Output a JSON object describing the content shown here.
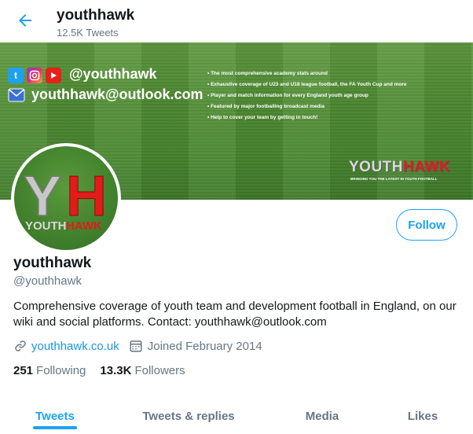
{
  "header": {
    "title": "youthhawk",
    "tweet_count": "12.5K Tweets"
  },
  "banner": {
    "handle": "@youthhawk",
    "email": "youthhawk@outlook.com",
    "bullets": [
      "• The most comprehensive academy stats around",
      "• Exhaustive coverage of U23 and U18 league football, the FA Youth Cup and more",
      "• Player and match information for every England youth age group",
      "• Featured by major footballing broadcast media",
      "• Help to cover your team by getting in touch!"
    ],
    "logo_left": "YOUTH",
    "logo_right": "HAWK",
    "tagline": "BRINGING YOU THE LATEST IN YOUTH FOOTBALL"
  },
  "avatar": {
    "letters_left": "Y",
    "letters_right": "H",
    "word_left": "YOUTH",
    "word_right": "HAWK"
  },
  "profile": {
    "name": "youthhawk",
    "handle": "@youthhawk",
    "bio": "Comprehensive coverage of youth team and development football in England, on our wiki and social platforms. Contact: youthhawk@outlook.com",
    "website": "youthhawk.co.uk",
    "joined": "Joined February 2014",
    "following_count": "251",
    "following_label": "Following",
    "followers_count": "13.3K",
    "followers_label": "Followers",
    "follow_label": "Follow"
  },
  "tabs": [
    {
      "label": "Tweets",
      "active": true
    },
    {
      "label": "Tweets & replies",
      "active": false
    },
    {
      "label": "Media",
      "active": false
    },
    {
      "label": "Likes",
      "active": false
    }
  ],
  "colors": {
    "accent": "#1da1f2",
    "brand_red": "#e21b1b",
    "banner_green": "#4f8c33"
  }
}
